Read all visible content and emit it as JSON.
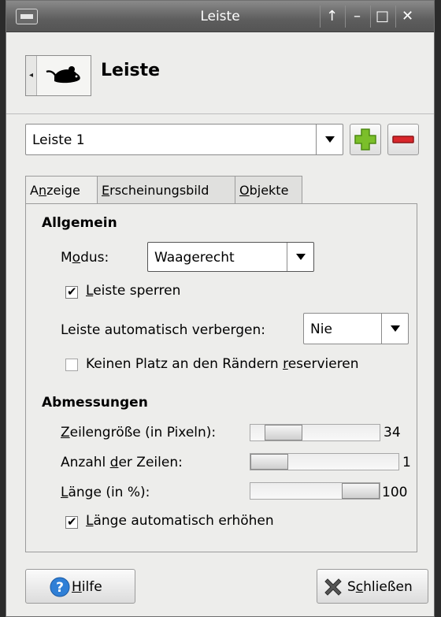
{
  "window": {
    "title": "Leiste",
    "buttons": [
      "↑",
      "–",
      "□",
      "✕"
    ]
  },
  "header": {
    "title": "Leiste"
  },
  "panel_selector": {
    "value": "Leiste 1"
  },
  "tabs": [
    {
      "pre": "A",
      "mn": "n",
      "post": "zeige",
      "active": true
    },
    {
      "pre": "",
      "mn": "E",
      "post": "rscheinungsbild",
      "active": false
    },
    {
      "pre": "",
      "mn": "O",
      "post": "bjekte",
      "active": false
    }
  ],
  "general": {
    "heading": "Allgemein",
    "mode_label_pre": "M",
    "mode_label_mn": "o",
    "mode_label_post": "dus:",
    "mode_value": "Waagerecht",
    "lock_pre": "",
    "lock_mn": "L",
    "lock_post": "eiste sperren",
    "lock_checked": true,
    "autohide_label": "Leiste automatisch verbergen:",
    "autohide_value": "Nie",
    "reserve_pre": "Keinen Platz an den Rändern ",
    "reserve_mn": "r",
    "reserve_post": "eservieren",
    "reserve_checked": false
  },
  "dimensions": {
    "heading": "Abmessungen",
    "row_size_pre": "",
    "row_size_mn": "Z",
    "row_size_post": "eilengröße (in Pixeln):",
    "row_size_value": "34",
    "rows_pre": "Anzahl ",
    "rows_mn": "d",
    "rows_post": "er Zeilen:",
    "rows_value": "1",
    "length_pre": "",
    "length_mn": "L",
    "length_post": "änge (in %):",
    "length_value": "100",
    "autogrow_pre": "",
    "autogrow_mn": "L",
    "autogrow_post": "änge automatisch erhöhen",
    "autogrow_checked": true
  },
  "footer": {
    "help_mn": "H",
    "help_post": "ilfe",
    "close_pre": "S",
    "close_mn": "c",
    "close_post": "hließen"
  },
  "colors": {
    "add": "#7bbf2a",
    "remove": "#d9262b",
    "help": "#2f7fd6"
  }
}
